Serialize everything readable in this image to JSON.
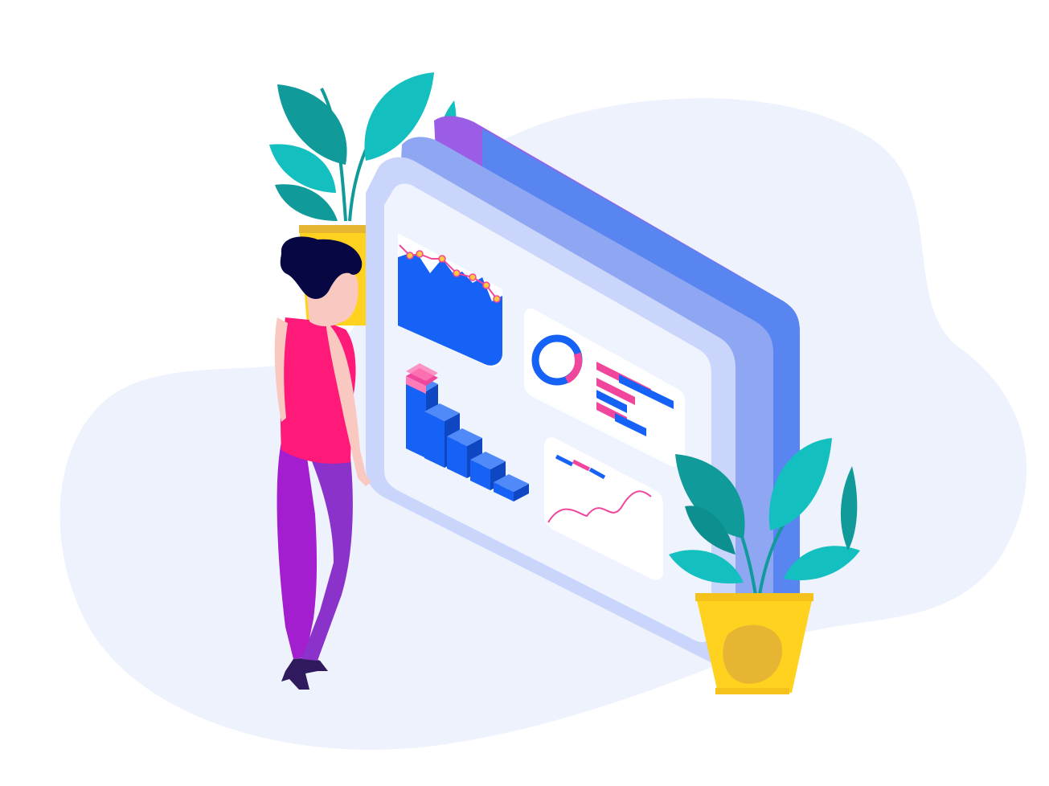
{
  "illustration": {
    "colors": {
      "background": "#ffffff",
      "blob": "#edf2fd",
      "board_back": "#9b5de5",
      "board_edge": "#8fa6f2",
      "board_face": "#c9d5fb",
      "screen": "#eef3fe",
      "panel": "#ffffff",
      "accent_blue": "#1762f6",
      "accent_pink": "#f0479c",
      "marker_yellow": "#ffc83d",
      "leaf_teal": "#13bfbf",
      "leaf_dark": "#109a9a",
      "pot_yellow": "#ffd21f",
      "pot_shade": "#e6b531",
      "shirt": "#ff1978",
      "pants": "#a21ecf",
      "hair": "#070743",
      "skin": "#f9c9c1",
      "shoes": "#2e1a5c"
    },
    "icons": [
      "area-chart-icon",
      "bar-chart-icon",
      "donut-chart-icon",
      "horizontal-bars-icon",
      "line-chart-icon",
      "plant-icon",
      "person-icon"
    ]
  }
}
